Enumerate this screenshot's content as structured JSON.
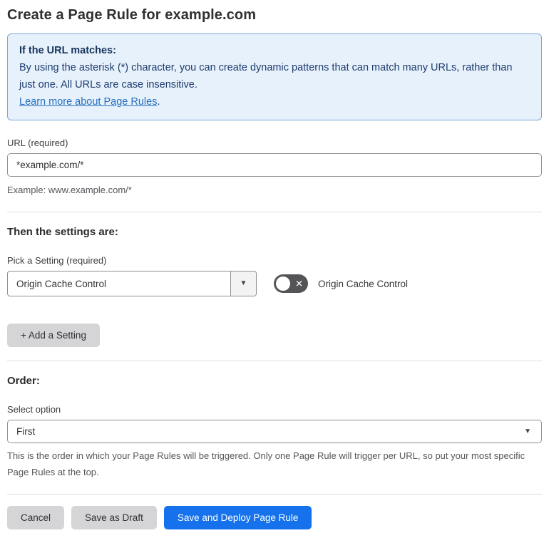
{
  "page": {
    "title": "Create a Page Rule for example.com"
  },
  "info_box": {
    "heading": "If the URL matches:",
    "body": "By using the asterisk (*) character, you can create dynamic patterns that can match many URLs, rather than just one. All URLs are case insensitive.",
    "link_label": "Learn more about Page Rules",
    "link_suffix": "."
  },
  "url_field": {
    "label": "URL (required)",
    "value": "*example.com/*",
    "helper": "Example: www.example.com/*"
  },
  "settings_section": {
    "heading": "Then the settings are:",
    "picker_label": "Pick a Setting (required)",
    "picker_value": "Origin Cache Control",
    "toggle_label": "Origin Cache Control",
    "toggle_state": "off",
    "toggle_off_glyph": "✕",
    "add_button_label": "+ Add a Setting"
  },
  "order_section": {
    "heading": "Order:",
    "select_label": "Select option",
    "select_value": "First",
    "helper": "This is the order in which your Page Rules will be triggered. Only one Page Rule will trigger per URL, so put your most specific Page Rules at the top."
  },
  "footer": {
    "cancel_label": "Cancel",
    "save_draft_label": "Save as Draft",
    "save_deploy_label": "Save and Deploy Page Rule"
  },
  "colors": {
    "accent_blue": "#1672ec",
    "info_background": "#e7f1fb",
    "info_border": "#7aa8d8",
    "info_text": "#1d3c6e",
    "link_blue": "#2570c1",
    "toggle_off_background": "#545456",
    "gray_button_background": "#d5d5d7"
  }
}
